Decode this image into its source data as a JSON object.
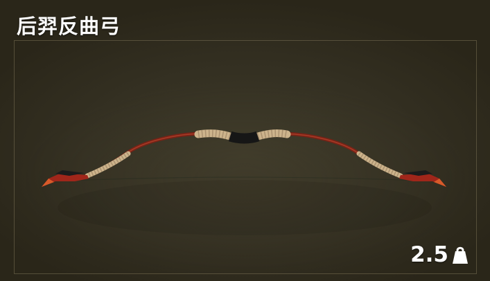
{
  "item": {
    "name": "后羿反曲弓",
    "weight": "2.5",
    "weight_icon": "kettlebell-weight-icon",
    "preview_image": "recurve-bow-icon"
  },
  "colors": {
    "background": "#2e2a1c",
    "panel_border": "#78704f",
    "text": "#ffffff",
    "bow_wood": "#8a2a1c",
    "bow_wrap": "#cdb48c",
    "bow_grip": "#1a1a1a"
  }
}
